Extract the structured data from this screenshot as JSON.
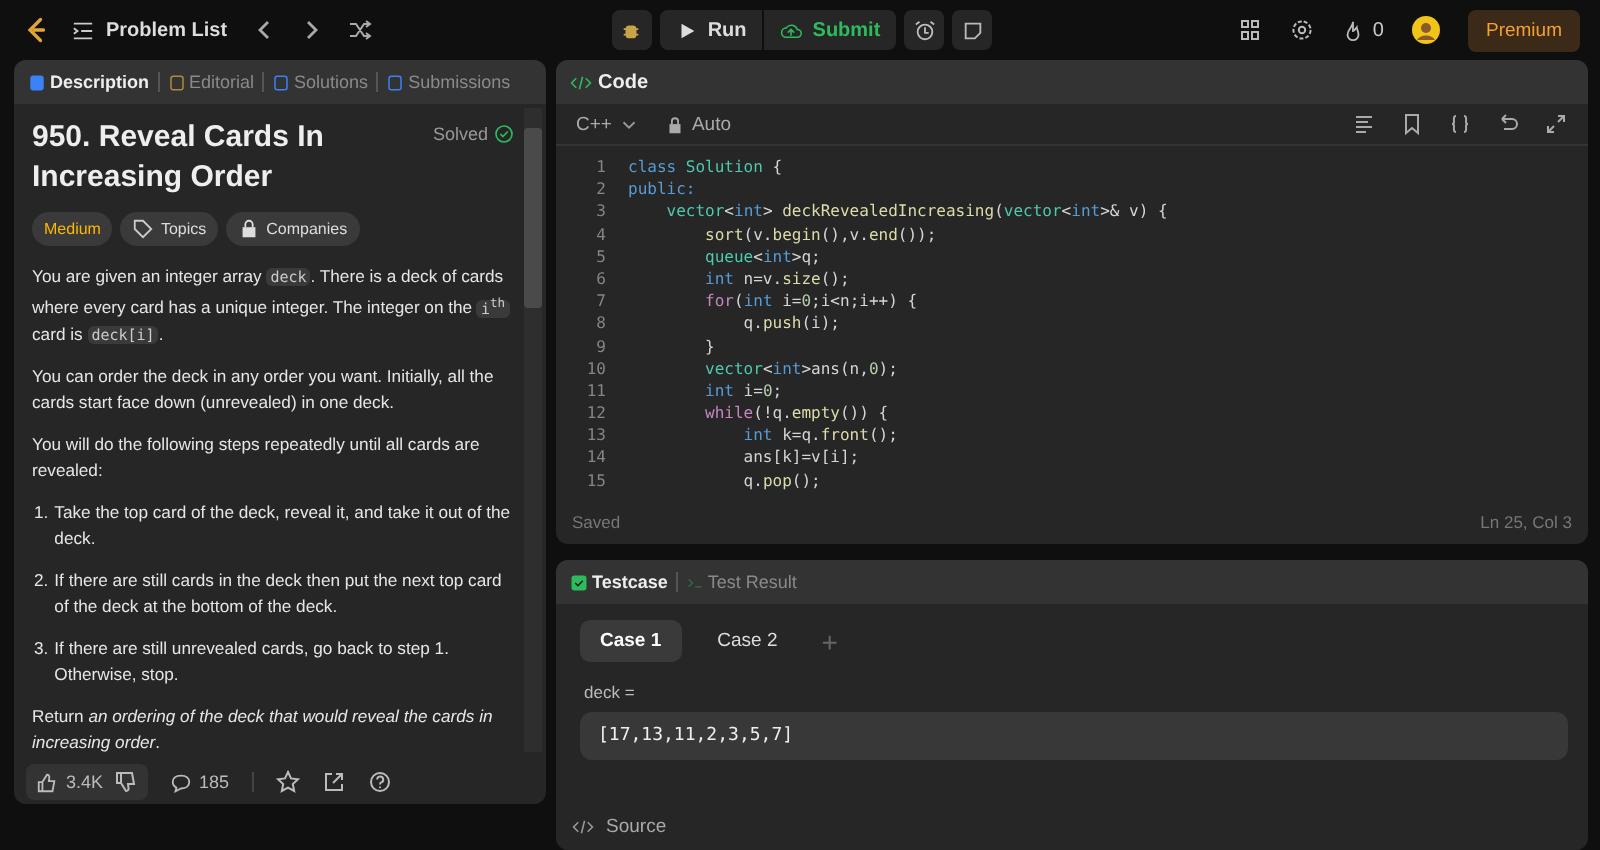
{
  "topbar": {
    "problem_list": "Problem List",
    "run": "Run",
    "submit": "Submit",
    "streak": "0",
    "premium": "Premium"
  },
  "description_panel": {
    "tabs": [
      {
        "label": "Description",
        "selected": true
      },
      {
        "label": "Editorial",
        "selected": false
      },
      {
        "label": "Solutions",
        "selected": false
      },
      {
        "label": "Submissions",
        "selected": false
      }
    ],
    "title": "950. Reveal Cards In Increasing Order",
    "status": "Solved",
    "difficulty": "Medium",
    "tags": [
      "Topics",
      "Companies"
    ],
    "paragraphs": [
      [
        {
          "kind": "text",
          "text": "You are given an integer array "
        },
        {
          "kind": "code",
          "text": "deck"
        },
        {
          "kind": "text",
          "text": ". There is a deck of cards where every card has a unique integer. The integer on the "
        },
        {
          "kind": "code",
          "text": "i$^{th}$"
        },
        {
          "kind": "text",
          "text": " card is "
        },
        {
          "kind": "code",
          "text": "deck[i]"
        },
        {
          "kind": "text",
          "text": "."
        }
      ],
      [
        {
          "kind": "text",
          "text": "You can order the deck in any order you want. Initially, all the cards start face down (unrevealed) in one deck."
        }
      ],
      [
        {
          "kind": "text",
          "text": "You will do the following steps repeatedly until all cards are revealed:"
        }
      ]
    ],
    "steps": [
      {
        "number": "1.",
        "text": "Take the top card of the deck, reveal it, and take it out of the deck."
      },
      {
        "number": "2.",
        "text": "If there are still cards in the deck then put the next top card of the deck at the bottom of the deck."
      },
      {
        "number": "3.",
        "text": "If there are still unrevealed cards, go back to step 1. Otherwise, stop."
      }
    ],
    "closing": [
      {
        "kind": "text",
        "text": "Return "
      },
      {
        "kind": "italic",
        "text": "an ordering of the deck that would reveal the cards in increasing order"
      },
      {
        "kind": "text",
        "text": "."
      }
    ],
    "likes": "3.4K",
    "comments": "185"
  },
  "code_panel": {
    "title": "Code",
    "language": "C++",
    "mode": "Auto",
    "lines": [
      {
        "number": "1",
        "tokens": [
          {
            "kind": "keyword",
            "text": "class "
          },
          {
            "kind": "type",
            "text": "Solution"
          },
          {
            "kind": "plain",
            "text": " {"
          }
        ]
      },
      {
        "number": "2",
        "tokens": [
          {
            "kind": "keyword",
            "text": "public:"
          }
        ]
      },
      {
        "number": "3",
        "tokens": [
          {
            "kind": "type",
            "text": "    vector"
          },
          {
            "kind": "plain",
            "text": "<"
          },
          {
            "kind": "keyword",
            "text": "int"
          },
          {
            "kind": "plain",
            "text": "> "
          },
          {
            "kind": "function",
            "text": "deckRevealedIncreasing"
          },
          {
            "kind": "plain",
            "text": "("
          },
          {
            "kind": "type",
            "text": "vector"
          },
          {
            "kind": "plain",
            "text": "<"
          },
          {
            "kind": "keyword",
            "text": "int"
          },
          {
            "kind": "plain",
            "text": ">& v) {"
          }
        ]
      },
      {
        "number": "4",
        "tokens": [
          {
            "kind": "function",
            "text": "        sort"
          },
          {
            "kind": "plain",
            "text": "(v."
          },
          {
            "kind": "function",
            "text": "begin"
          },
          {
            "kind": "plain",
            "text": "(),v."
          },
          {
            "kind": "function",
            "text": "end"
          },
          {
            "kind": "plain",
            "text": "());"
          }
        ]
      },
      {
        "number": "5",
        "tokens": [
          {
            "kind": "type",
            "text": "        queue"
          },
          {
            "kind": "plain",
            "text": "<"
          },
          {
            "kind": "keyword",
            "text": "int"
          },
          {
            "kind": "plain",
            "text": ">q;"
          }
        ]
      },
      {
        "number": "6",
        "tokens": [
          {
            "kind": "keyword",
            "text": "        int"
          },
          {
            "kind": "plain",
            "text": " n=v."
          },
          {
            "kind": "function",
            "text": "size"
          },
          {
            "kind": "plain",
            "text": "();"
          }
        ]
      },
      {
        "number": "7",
        "tokens": [
          {
            "kind": "control",
            "text": "        for"
          },
          {
            "kind": "plain",
            "text": "("
          },
          {
            "kind": "keyword",
            "text": "int"
          },
          {
            "kind": "plain",
            "text": " i="
          },
          {
            "kind": "number",
            "text": "0"
          },
          {
            "kind": "plain",
            "text": ";i<n;i++) {"
          }
        ]
      },
      {
        "number": "8",
        "tokens": [
          {
            "kind": "plain",
            "text": "            q."
          },
          {
            "kind": "function",
            "text": "push"
          },
          {
            "kind": "plain",
            "text": "(i);"
          }
        ]
      },
      {
        "number": "9",
        "tokens": [
          {
            "kind": "plain",
            "text": "        }"
          }
        ]
      },
      {
        "number": "10",
        "tokens": [
          {
            "kind": "type",
            "text": "        vector"
          },
          {
            "kind": "plain",
            "text": "<"
          },
          {
            "kind": "keyword",
            "text": "int"
          },
          {
            "kind": "plain",
            "text": ">ans(n,"
          },
          {
            "kind": "number",
            "text": "0"
          },
          {
            "kind": "plain",
            "text": ");"
          }
        ]
      },
      {
        "number": "11",
        "tokens": [
          {
            "kind": "keyword",
            "text": "        int"
          },
          {
            "kind": "plain",
            "text": " i="
          },
          {
            "kind": "number",
            "text": "0"
          },
          {
            "kind": "plain",
            "text": ";"
          }
        ]
      },
      {
        "number": "12",
        "tokens": [
          {
            "kind": "control",
            "text": "        while"
          },
          {
            "kind": "plain",
            "text": "(!q."
          },
          {
            "kind": "function",
            "text": "empty"
          },
          {
            "kind": "plain",
            "text": "()) {"
          }
        ]
      },
      {
        "number": "13",
        "tokens": [
          {
            "kind": "keyword",
            "text": "            int"
          },
          {
            "kind": "plain",
            "text": " k=q."
          },
          {
            "kind": "function",
            "text": "front"
          },
          {
            "kind": "plain",
            "text": "();"
          }
        ]
      },
      {
        "number": "14",
        "tokens": [
          {
            "kind": "plain",
            "text": "            ans[k]=v[i];"
          }
        ]
      },
      {
        "number": "15",
        "tokens": [
          {
            "kind": "plain",
            "text": "            q."
          },
          {
            "kind": "function",
            "text": "pop"
          },
          {
            "kind": "plain",
            "text": "();"
          }
        ]
      }
    ],
    "status": "Saved",
    "cursor": "Ln 25, Col 3"
  },
  "test_panel": {
    "tabs": [
      {
        "label": "Testcase",
        "selected": true
      },
      {
        "label": "Test Result",
        "selected": false
      }
    ],
    "cases": [
      {
        "label": "Case 1",
        "selected": true
      },
      {
        "label": "Case 2",
        "selected": false
      }
    ],
    "add": "+",
    "param_label": "deck =",
    "param_value": "[17,13,11,2,3,5,7]",
    "source": "Source"
  }
}
